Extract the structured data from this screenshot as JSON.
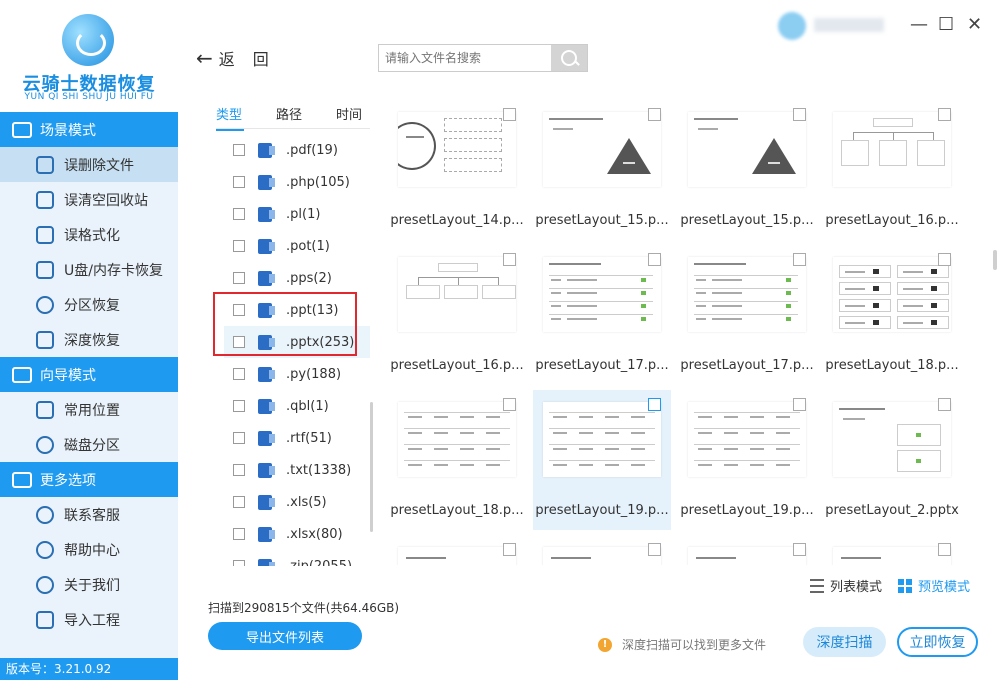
{
  "app": {
    "logo_name": "云骑士数据恢复",
    "logo_sub": "YUN QI SHI SHU JU HUI FU",
    "version": "版本号：3.21.0.92"
  },
  "sidebar": {
    "sections": [
      {
        "title": "场景模式",
        "icon": "scene-icon",
        "items": [
          {
            "label": "误删除文件",
            "icon": "deleted-file-icon",
            "active": true
          },
          {
            "label": "误清空回收站",
            "icon": "recycle-bin-icon"
          },
          {
            "label": "误格式化",
            "icon": "format-icon"
          },
          {
            "label": "U盘/内存卡恢复",
            "icon": "usb-card-icon"
          },
          {
            "label": "分区恢复",
            "icon": "partition-icon"
          },
          {
            "label": "深度恢复",
            "icon": "deep-restore-icon"
          }
        ]
      },
      {
        "title": "向导模式",
        "icon": "guide-icon",
        "items": [
          {
            "label": "常用位置",
            "icon": "windows-icon"
          },
          {
            "label": "磁盘分区",
            "icon": "disk-icon"
          }
        ]
      },
      {
        "title": "更多选项",
        "icon": "menu-icon",
        "items": [
          {
            "label": "联系客服",
            "icon": "phone-icon"
          },
          {
            "label": "帮助中心",
            "icon": "help-icon"
          },
          {
            "label": "关于我们",
            "icon": "info-icon"
          },
          {
            "label": "导入工程",
            "icon": "import-icon"
          }
        ]
      }
    ]
  },
  "toolbar": {
    "back_label": "返",
    "back_label2": "回",
    "search_placeholder": "请输入文件名搜索"
  },
  "window": {
    "minimize": "—",
    "maximize": "☐",
    "close": "✕"
  },
  "filter_tabs": [
    "类型",
    "路径",
    "时间"
  ],
  "file_types": [
    {
      "label": ".pdf(19)"
    },
    {
      "label": ".php(105)"
    },
    {
      "label": ".pl(1)"
    },
    {
      "label": ".pot(1)"
    },
    {
      "label": ".pps(2)"
    },
    {
      "label": ".ppt(13)"
    },
    {
      "label": ".pptx(253)",
      "selected": true
    },
    {
      "label": ".py(188)"
    },
    {
      "label": ".qbl(1)"
    },
    {
      "label": ".rtf(51)"
    },
    {
      "label": ".txt(1338)"
    },
    {
      "label": ".xls(5)"
    },
    {
      "label": ".xlsx(80)"
    },
    {
      "label": ".zip(2055)"
    }
  ],
  "files": [
    {
      "name": "presetLayout_14.p...",
      "thumb": "circle"
    },
    {
      "name": "presetLayout_15.p...",
      "thumb": "pyramid"
    },
    {
      "name": "presetLayout_15.p...",
      "thumb": "pyramid2"
    },
    {
      "name": "presetLayout_16.p...",
      "thumb": "org"
    },
    {
      "name": "presetLayout_16.p...",
      "thumb": "org2"
    },
    {
      "name": "presetLayout_17.p...",
      "thumb": "list"
    },
    {
      "name": "presetLayout_17.p...",
      "thumb": "list"
    },
    {
      "name": "presetLayout_18.p...",
      "thumb": "iconlist"
    },
    {
      "name": "presetLayout_18.p...",
      "thumb": "table"
    },
    {
      "name": "presetLayout_19.p...",
      "thumb": "table",
      "selected": true
    },
    {
      "name": "presetLayout_19.p...",
      "thumb": "table"
    },
    {
      "name": "presetLayout_2.pptx",
      "thumb": "images"
    },
    {
      "name": "",
      "thumb": "partial"
    },
    {
      "name": "",
      "thumb": "partial"
    },
    {
      "name": "",
      "thumb": "partial"
    },
    {
      "name": "",
      "thumb": "partial"
    }
  ],
  "view_modes": {
    "list": "列表模式",
    "preview": "预览模式"
  },
  "footer": {
    "scan_info": "扫描到290815个文件(共64.46GB)",
    "export_label": "导出文件列表",
    "tip": "深度扫描可以找到更多文件",
    "deep_scan": "深度扫描",
    "recover": "立即恢复"
  },
  "colors": {
    "accent": "#1e9af0",
    "highlight_box": "#e0282e"
  }
}
